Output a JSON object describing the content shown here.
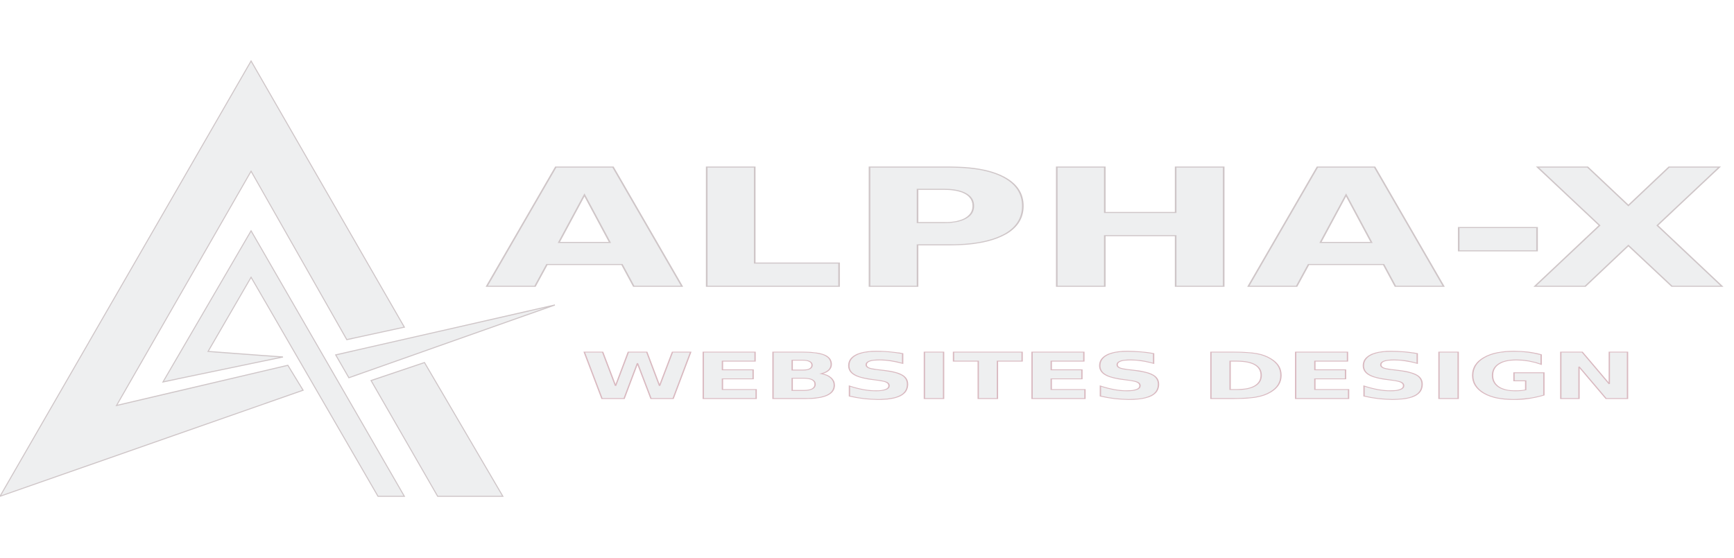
{
  "logo": {
    "title": "ALPHA-X",
    "subtitle": "WEBSITES DESIGN",
    "colors": {
      "fill": "#eeeff0",
      "stroke": "#cfc6c8",
      "background": "#ffffff"
    },
    "icon": "stylized-a-with-arrow-icon"
  }
}
